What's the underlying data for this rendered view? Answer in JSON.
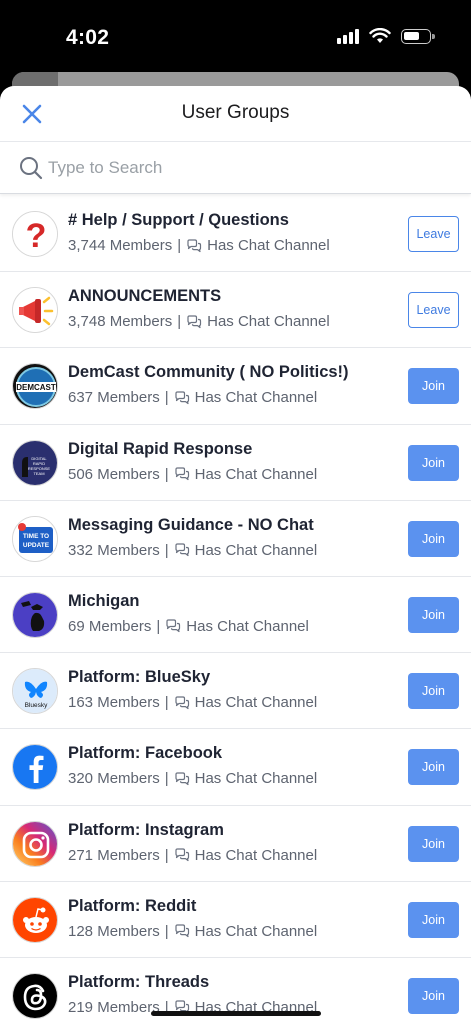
{
  "status_bar": {
    "time": "4:02",
    "icons": [
      "signal-icon",
      "wifi-icon",
      "battery-icon"
    ]
  },
  "header": {
    "title": "User Groups",
    "close_icon": "close-icon"
  },
  "search": {
    "placeholder": "Type to Search",
    "icon": "search-icon"
  },
  "colors": {
    "accent": "#4a86e8",
    "join_bg": "#5b92ef",
    "title": "#1f2433",
    "meta": "#5e6470"
  },
  "groups": [
    {
      "name": "# Help / Support / Questions",
      "members": "3,744 Members",
      "separator": "|",
      "channel": "Has Chat Channel",
      "action": "Leave",
      "avatar": "question-mark-avatar"
    },
    {
      "name": "ANNOUNCEMENTS",
      "members": "3,748 Members",
      "separator": "|",
      "channel": "Has Chat Channel",
      "action": "Leave",
      "avatar": "megaphone-avatar"
    },
    {
      "name": "DemCast Community ( NO Politics!)",
      "members": "637 Members",
      "separator": "|",
      "channel": "Has Chat Channel",
      "action": "Join",
      "avatar": "demcast-logo-avatar",
      "avatar_text": "DEMCAST"
    },
    {
      "name": "Digital Rapid Response",
      "members": "506 Members",
      "separator": "|",
      "channel": "Has Chat Channel",
      "action": "Join",
      "avatar": "digital-rapid-response-avatar",
      "avatar_text": "DIGITAL RAPID RESPONSE TEAM"
    },
    {
      "name": "Messaging Guidance - NO Chat",
      "members": "332 Members",
      "separator": "|",
      "channel": "Has Chat Channel",
      "action": "Join",
      "avatar": "time-to-update-avatar",
      "avatar_text": "TIME TO UPDATE"
    },
    {
      "name": "Michigan",
      "members": "69 Members",
      "separator": "|",
      "channel": "Has Chat Channel",
      "action": "Join",
      "avatar": "michigan-map-avatar"
    },
    {
      "name": "Platform: BlueSky",
      "members": "163 Members",
      "separator": "|",
      "channel": "Has Chat Channel",
      "action": "Join",
      "avatar": "bluesky-logo-avatar",
      "avatar_text": "Bluesky"
    },
    {
      "name": "Platform: Facebook",
      "members": "320 Members",
      "separator": "|",
      "channel": "Has Chat Channel",
      "action": "Join",
      "avatar": "facebook-logo-avatar"
    },
    {
      "name": "Platform: Instagram",
      "members": "271 Members",
      "separator": "|",
      "channel": "Has Chat Channel",
      "action": "Join",
      "avatar": "instagram-logo-avatar"
    },
    {
      "name": "Platform: Reddit",
      "members": "128 Members",
      "separator": "|",
      "channel": "Has Chat Channel",
      "action": "Join",
      "avatar": "reddit-logo-avatar"
    },
    {
      "name": "Platform: Threads",
      "members": "219 Members",
      "separator": "|",
      "channel": "Has Chat Channel",
      "action": "Join",
      "avatar": "threads-logo-avatar"
    }
  ]
}
